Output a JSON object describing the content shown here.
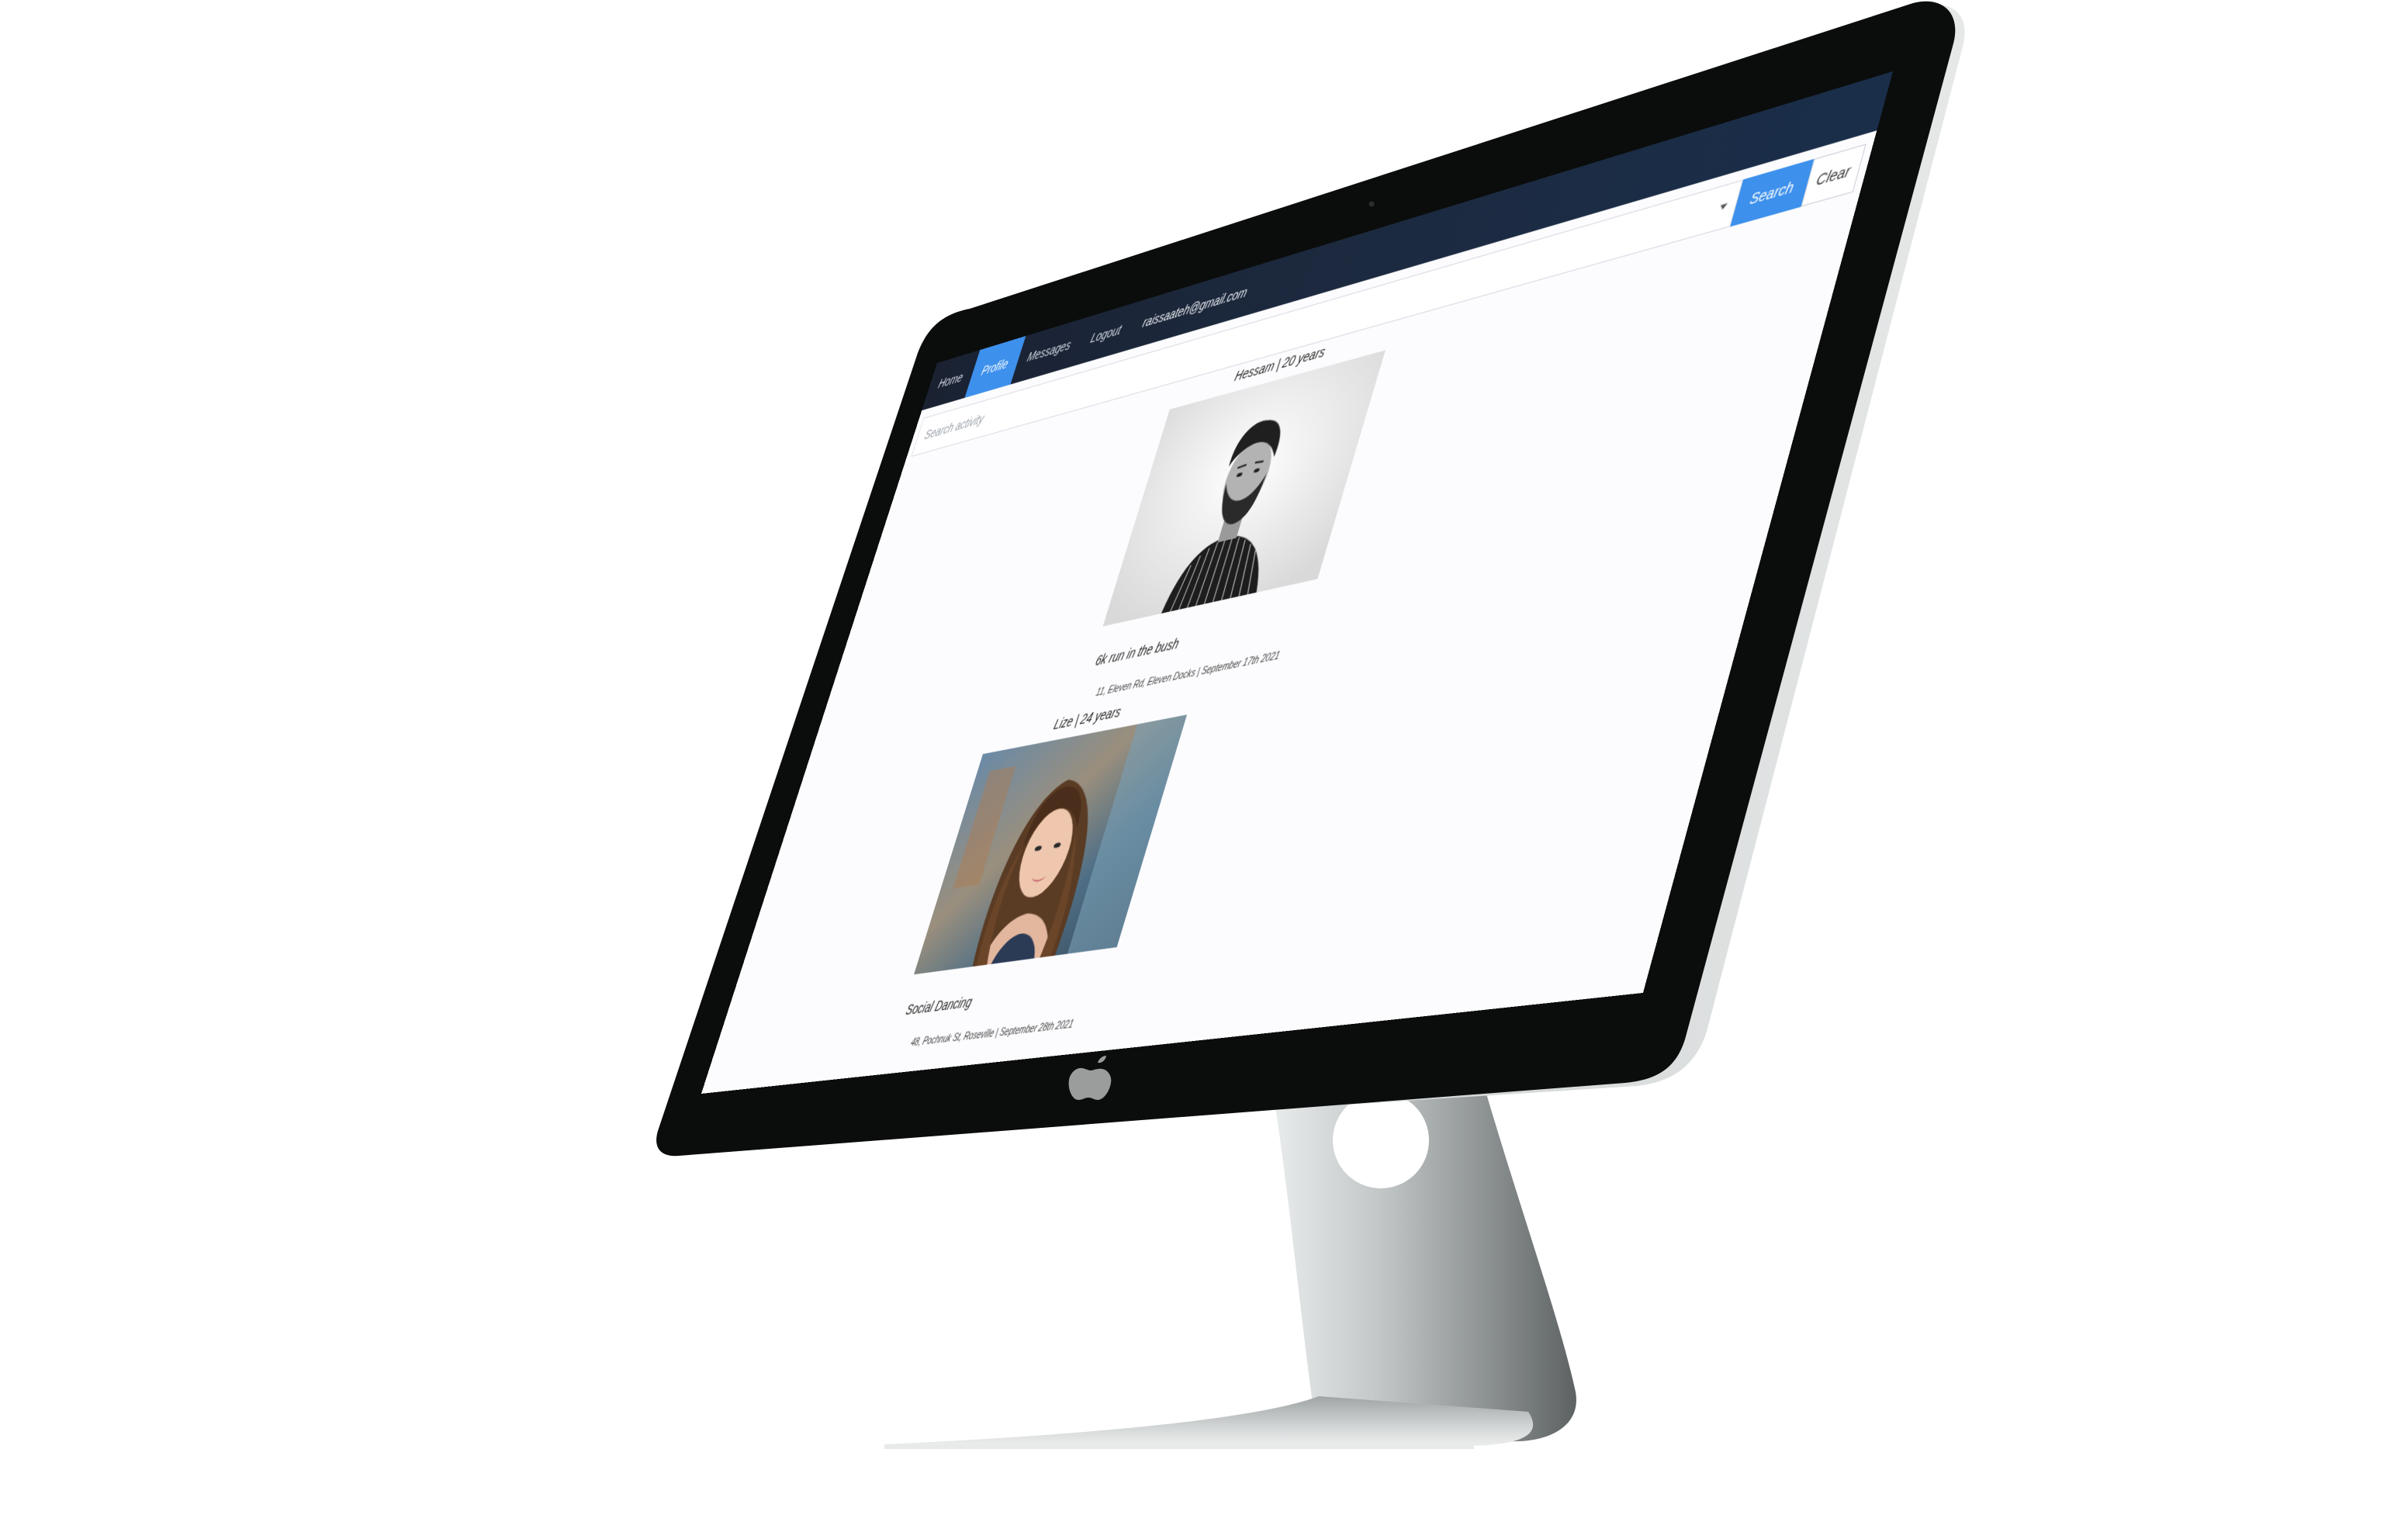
{
  "navbar": {
    "items": [
      {
        "label": "Home",
        "active": false
      },
      {
        "label": "Profile",
        "active": true
      },
      {
        "label": "Messages",
        "active": false
      },
      {
        "label": "Logout",
        "active": false
      }
    ],
    "user_email": "raissaateh@gmail.com"
  },
  "search": {
    "placeholder": "Search activity",
    "value": "",
    "search_label": "Search",
    "clear_label": "Clear"
  },
  "results": [
    {
      "title": "Hessam | 20 years",
      "activity": "6k run in the bush",
      "meta": "11, Eleven Rd, Eleven Docks | September 17th 2021",
      "photo": "man-portrait-bw"
    },
    {
      "title": "Lize | 24 years",
      "activity": "Social Dancing",
      "meta": "48, Pochnuk St, Roseville | September 28th 2021",
      "photo": "woman-portrait-color"
    }
  ],
  "colors": {
    "navbar": "#1b2535",
    "accent": "#3d90ec",
    "bezel": "#0b0d0c",
    "stand": "#c9cccd"
  }
}
